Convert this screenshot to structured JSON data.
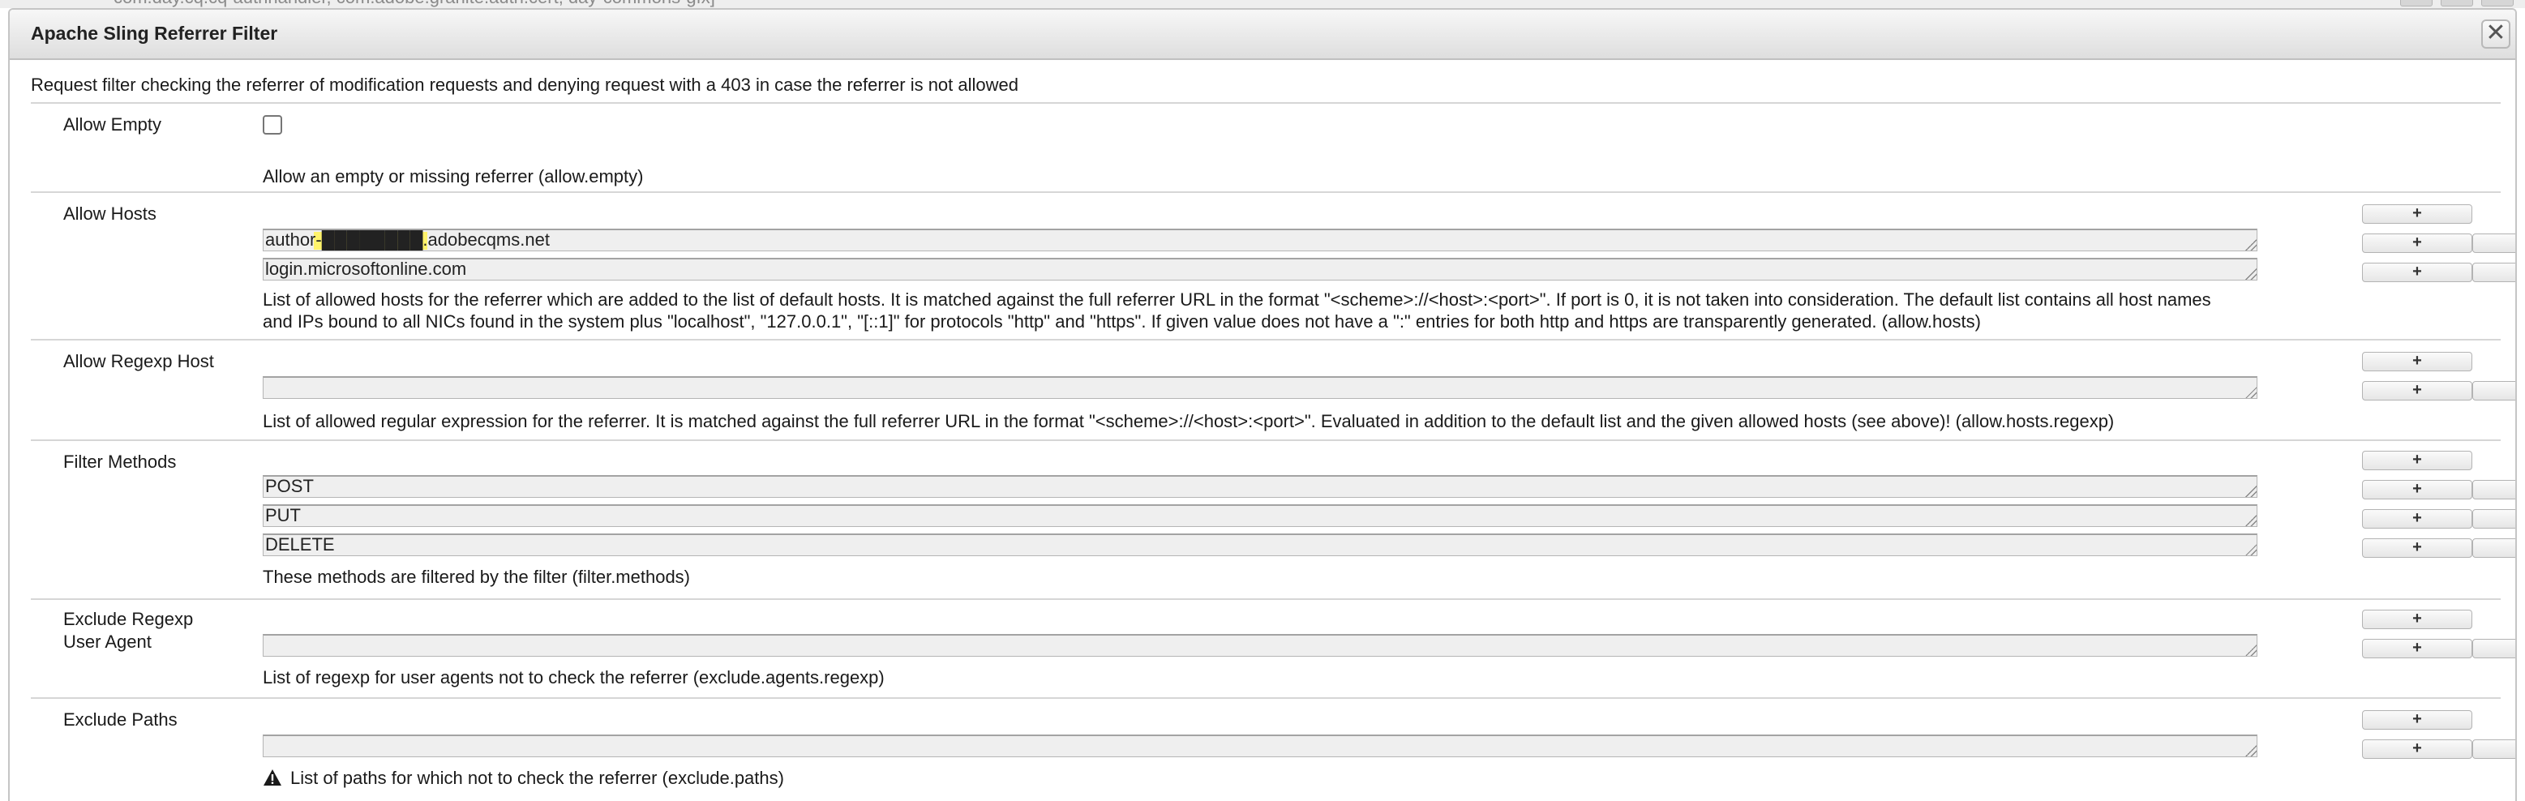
{
  "background_window": {
    "text": "com.day.cq.cq-authhandler, com.adobe.granite.auth.cert, day-commons-gfx]"
  },
  "dialog": {
    "title": "Apache Sling Referrer Filter",
    "close_icon": "close-icon",
    "description": "Request filter checking the referrer of modification requests and denying request with a 403 in case the referrer is not allowed"
  },
  "buttons": {
    "add": "+",
    "remove": "-"
  },
  "sections": {
    "allow_empty": {
      "label": "Allow Empty",
      "checked": false,
      "help": "Allow an empty or missing referrer (allow.empty)"
    },
    "allow_hosts": {
      "label": "Allow Hosts",
      "values": [
        "author-████████.adobecqms.net",
        "login.microsoftonline.com"
      ],
      "help_line1": "List of allowed hosts for the referrer which are added to the list of default hosts. It is matched against the full referrer URL in the format \"<scheme>://<host>:<port>\". If port is 0, it is not taken into consideration. The default list contains all host names",
      "help_line2": "and IPs bound to all NICs found in the system plus \"localhost\", \"127.0.0.1\", \"[::1]\" for protocols \"http\" and \"https\". If given value does not have a \":\" entries for both http and https are transparently generated. (allow.hosts)"
    },
    "allow_regexp_host": {
      "label": "Allow Regexp Host",
      "values": [
        ""
      ],
      "help": "List of allowed regular expression for the referrer. It is matched against the full referrer URL in the format \"<scheme>://<host>:<port>\". Evaluated in addition to the default list and the given allowed hosts (see above)! (allow.hosts.regexp)"
    },
    "filter_methods": {
      "label": "Filter Methods",
      "values": [
        "POST",
        "PUT",
        "DELETE"
      ],
      "help": "These methods are filtered by the filter (filter.methods)"
    },
    "exclude_regexp_user_agent": {
      "label_line1": "Exclude Regexp",
      "label_line2": "User Agent",
      "values": [
        ""
      ],
      "help": "List of regexp for user agents not to check the referrer (exclude.agents.regexp)"
    },
    "exclude_paths": {
      "label": "Exclude Paths",
      "values": [
        ""
      ],
      "help": "List of paths for which not to check the referrer (exclude.paths)",
      "help_icon": "warning-icon"
    }
  }
}
